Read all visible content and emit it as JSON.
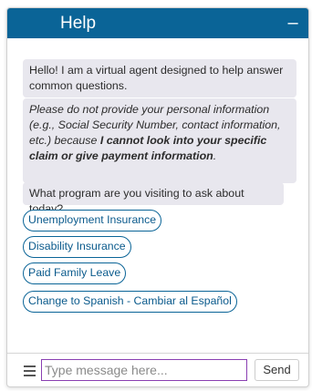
{
  "header": {
    "title": "Help",
    "minimize_icon": "minus-icon",
    "minimize_glyph": "–"
  },
  "messages": {
    "greeting": "Hello! I am a virtual agent designed to help answer common questions.",
    "privacy_part1": "Please do not provide your personal information (e.g., Social Security Number, contact information, etc.) because ",
    "privacy_bold": "I cannot look into your specific claim or give payment information",
    "privacy_end": ".",
    "question": "What program are you visiting to ask about today?"
  },
  "options": [
    "Unemployment Insurance",
    "Disability Insurance",
    "Paid Family Leave",
    "Change to Spanish - Cambiar al Español"
  ],
  "composer": {
    "menu_icon": "hamburger-menu-icon",
    "placeholder": "Type message here...",
    "send_label": "Send"
  },
  "colors": {
    "header_bg": "#0a6497",
    "bubble_bg": "#e8e7ee",
    "option_border": "#0a6497",
    "input_border": "#8a3fb2"
  }
}
